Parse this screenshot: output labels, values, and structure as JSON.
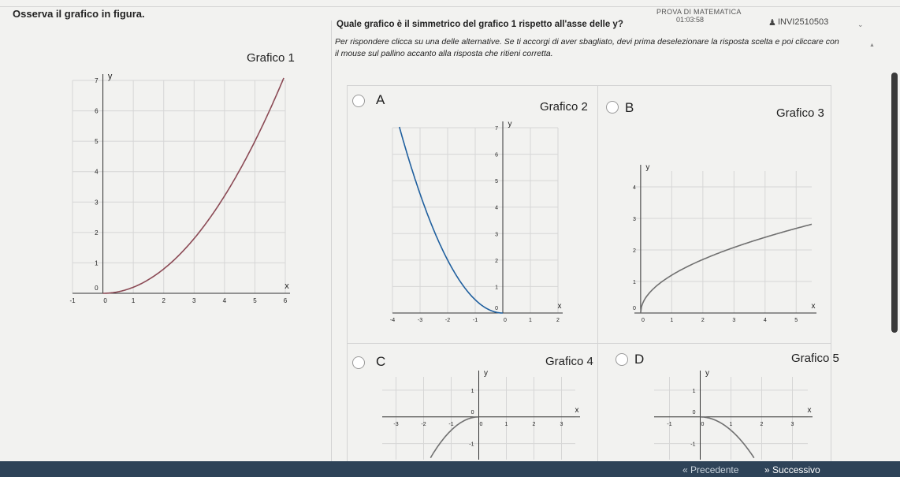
{
  "header": {
    "instruction": "Osserva il grafico in figura.",
    "exam_title": "PROVA DI MATEMATICA",
    "timer": "01:03:58",
    "user_id": "INVI2510503",
    "question": "Quale grafico è il simmetrico del grafico 1 rispetto all'asse delle y?",
    "hint": "Per rispondere clicca su una delle alternative. Se ti accorgi di aver sbagliato, devi prima deselezionare la risposta scelta e poi cliccare con il mouse sul pallino accanto alla risposta che ritieni corretta."
  },
  "graph1": {
    "title": "Grafico 1",
    "xlabel": "x",
    "ylabel": "y",
    "xticks": [
      "-1",
      "0",
      "1",
      "2",
      "3",
      "4",
      "5",
      "6"
    ],
    "yticks": [
      "0",
      "1",
      "2",
      "3",
      "4",
      "5",
      "6",
      "7"
    ]
  },
  "options": [
    {
      "letter": "A",
      "graph_title": "Grafico 2",
      "xticks": [
        "-4",
        "-3",
        "-2",
        "-1",
        "0",
        "1",
        "2"
      ],
      "yticks": [
        "0",
        "1",
        "2",
        "3",
        "4",
        "5",
        "6",
        "7"
      ],
      "xlabel": "x",
      "ylabel": "y"
    },
    {
      "letter": "B",
      "graph_title": "Grafico 3",
      "xticks": [
        "0",
        "1",
        "2",
        "3",
        "4",
        "5"
      ],
      "yticks": [
        "0",
        "1",
        "2",
        "3",
        "4"
      ],
      "xlabel": "x",
      "ylabel": "y"
    },
    {
      "letter": "C",
      "graph_title": "Grafico 4",
      "xticks": [
        "-3",
        "-2",
        "-1",
        "0",
        "1",
        "2",
        "3"
      ],
      "yticks": [
        "1",
        "0",
        "-1"
      ],
      "xlabel": "x",
      "ylabel": "y"
    },
    {
      "letter": "D",
      "graph_title": "Grafico 5",
      "xticks": [
        "-1",
        "0",
        "1",
        "2",
        "3"
      ],
      "yticks": [
        "1",
        "0",
        "-1"
      ],
      "xlabel": "x",
      "ylabel": "y"
    }
  ],
  "colors": {
    "curve1": "#8b4a55",
    "curve_blue": "#1f5f9e",
    "curve_gray": "#707070",
    "nav_bar": "#2e4358"
  },
  "nav": {
    "prev": "Precedente",
    "next": "Successivo"
  },
  "icons": {
    "prev": "double-left-arrow-icon",
    "next": "double-right-arrow-icon",
    "user": "user-icon",
    "dropdown": "chevron-down-icon"
  }
}
